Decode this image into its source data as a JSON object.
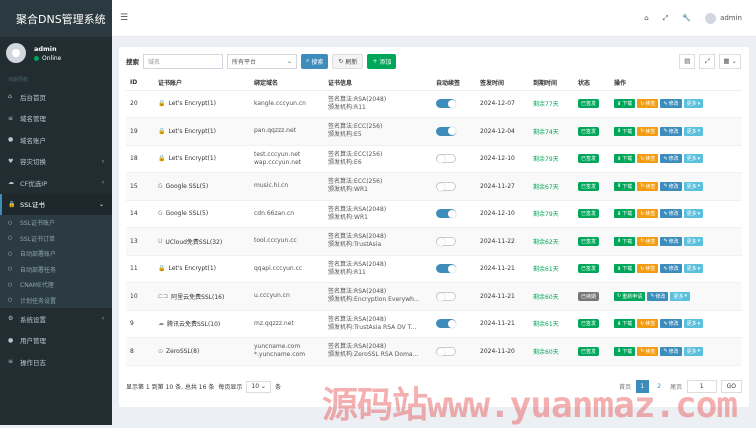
{
  "app": {
    "title": "聚合DNS管理系统"
  },
  "user": {
    "name": "admin",
    "status": "Online"
  },
  "sidebar": {
    "header": "功能导航",
    "items": [
      {
        "label": "后台首页",
        "icon": "home-icon"
      },
      {
        "label": "域名管理",
        "icon": "list-icon"
      },
      {
        "label": "域名账户",
        "icon": "user-icon"
      },
      {
        "label": "容灾切换",
        "icon": "heart-icon"
      },
      {
        "label": "CF优选IP",
        "icon": "cloud-icon"
      },
      {
        "label": "SSL证书",
        "icon": "lock-icon"
      }
    ],
    "ssl_sub": [
      "SSL证书账户",
      "SSL证书订单",
      "自动部署账户",
      "自动部署任务",
      "CNAME代理",
      "计划任务设置"
    ],
    "bottom_items": [
      {
        "label": "系统设置",
        "icon": "gear-icon"
      },
      {
        "label": "用户管理",
        "icon": "user-icon"
      },
      {
        "label": "操作日志",
        "icon": "list-icon"
      }
    ]
  },
  "toolbar": {
    "search_label": "搜索",
    "domain_placeholder": "域名",
    "platform_select": "所有平台",
    "search_btn": "搜索",
    "refresh_btn": "刷新",
    "add_btn": "添加"
  },
  "table": {
    "headers": [
      "ID",
      "证书账户",
      "绑定域名",
      "证书信息",
      "自动续签",
      "签发时间",
      "到期时间",
      "状态",
      "操作"
    ],
    "rows": [
      {
        "id": "20",
        "account": "Let's Encrypt(1)",
        "ca_icon": "lock-icon",
        "domain1": "kangle.cccyun.cn",
        "domain2": "",
        "algo": "签名算法:RSA(2048)",
        "issuer": "颁发机构:R11",
        "auto": true,
        "issued": "2024-12-07",
        "expire": "剩余77天",
        "status": "已签发",
        "status_type": "green",
        "ops": [
          "下载",
          "续签",
          "修改",
          "更多"
        ]
      },
      {
        "id": "19",
        "account": "Let's Encrypt(1)",
        "ca_icon": "lock-icon",
        "domain1": "pan.qqzzz.net",
        "domain2": "",
        "algo": "签名算法:ECC(256)",
        "issuer": "颁发机构:E5",
        "auto": true,
        "issued": "2024-12-04",
        "expire": "剩余74天",
        "status": "已签发",
        "status_type": "green",
        "ops": [
          "下载",
          "续签",
          "修改",
          "更多"
        ]
      },
      {
        "id": "18",
        "account": "Let's Encrypt(1)",
        "ca_icon": "lock-icon",
        "domain1": "test.cccyun.net",
        "domain2": "wap.cccyun.net",
        "algo": "签名算法:ECC(256)",
        "issuer": "颁发机构:E6",
        "auto": false,
        "issued": "2024-12-10",
        "expire": "剩余79天",
        "status": "已签发",
        "status_type": "green",
        "ops": [
          "下载",
          "续签",
          "修改",
          "更多"
        ]
      },
      {
        "id": "15",
        "account": "Google SSL(5)",
        "ca_icon": "google-icon",
        "domain1": "music.hi.cn",
        "domain2": "",
        "algo": "签名算法:ECC(256)",
        "issuer": "颁发机构:WR1",
        "auto": false,
        "issued": "2024-11-27",
        "expire": "剩余67天",
        "status": "已签发",
        "status_type": "green",
        "ops": [
          "下载",
          "续签",
          "修改",
          "更多"
        ]
      },
      {
        "id": "14",
        "account": "Google SSL(5)",
        "ca_icon": "google-icon",
        "domain1": "cdn.66zan.cn",
        "domain2": "",
        "algo": "签名算法:RSA(2048)",
        "issuer": "颁发机构:WR1",
        "auto": true,
        "issued": "2024-12-10",
        "expire": "剩余79天",
        "status": "已签发",
        "status_type": "green",
        "ops": [
          "下载",
          "续签",
          "修改",
          "更多"
        ]
      },
      {
        "id": "13",
        "account": "UCloud免费SSL(32)",
        "ca_icon": "ucloud-icon",
        "domain1": "tool.cccyun.cc",
        "domain2": "",
        "algo": "签名算法:RSA(2048)",
        "issuer": "颁发机构:TrustAsia",
        "auto": false,
        "issued": "2024-11-22",
        "expire": "剩余62天",
        "status": "已签发",
        "status_type": "green",
        "ops": [
          "下载",
          "续签",
          "修改",
          "更多"
        ]
      },
      {
        "id": "11",
        "account": "Let's Encrypt(1)",
        "ca_icon": "lock-icon",
        "domain1": "qqapi.cccyun.cc",
        "domain2": "",
        "algo": "签名算法:RSA(2048)",
        "issuer": "颁发机构:R11",
        "auto": true,
        "issued": "2024-11-21",
        "expire": "剩余61天",
        "status": "已签发",
        "status_type": "green",
        "ops": [
          "下载",
          "续签",
          "修改",
          "更多"
        ]
      },
      {
        "id": "10",
        "account": "阿里云免费SSL(16)",
        "ca_icon": "aliyun-icon",
        "domain1": "u.cccyun.cn",
        "domain2": "",
        "algo": "签名算法:RSA(2048)",
        "issuer": "颁发机构:Encryption Everywh...",
        "auto": false,
        "issued": "2024-11-21",
        "expire": "剩余60天",
        "status": "已续期",
        "status_type": "gray",
        "ops": [
          "重新申请",
          "修改",
          "更多"
        ]
      },
      {
        "id": "9",
        "account": "腾讯云免费SSL(10)",
        "ca_icon": "tencent-icon",
        "domain1": "mz.qqzzz.net",
        "domain2": "",
        "algo": "签名算法:RSA(2048)",
        "issuer": "颁发机构:TrustAsia RSA DV T...",
        "auto": true,
        "issued": "2024-11-21",
        "expire": "剩余61天",
        "status": "已签发",
        "status_type": "green",
        "ops": [
          "下载",
          "续签",
          "修改",
          "更多"
        ]
      },
      {
        "id": "8",
        "account": "ZeroSSL(8)",
        "ca_icon": "zerossl-icon",
        "domain1": "yuncname.com",
        "domain2": "*.yuncname.com",
        "algo": "签名算法:RSA(2048)",
        "issuer": "颁发机构:ZeroSSL RSA Doma...",
        "auto": false,
        "issued": "2024-11-20",
        "expire": "剩余60天",
        "status": "已签发",
        "status_type": "green",
        "ops": [
          "下载",
          "续签",
          "修改",
          "更多"
        ]
      }
    ]
  },
  "pager": {
    "summary": "显示第 1 到第 10 条, 总共 16 条",
    "per_page_label": "每页显示",
    "per_page": "10",
    "per_page_suffix": "条",
    "first": "首页",
    "pages": [
      "1",
      "2"
    ],
    "last": "尾页",
    "jump_value": "1",
    "go": "GO"
  },
  "watermark": "源码站www.yuanmaz.com",
  "colors": {
    "accent": "#3c8dbc",
    "success": "#00a65a",
    "warning": "#f39c12",
    "sidebar": "#222d32"
  }
}
